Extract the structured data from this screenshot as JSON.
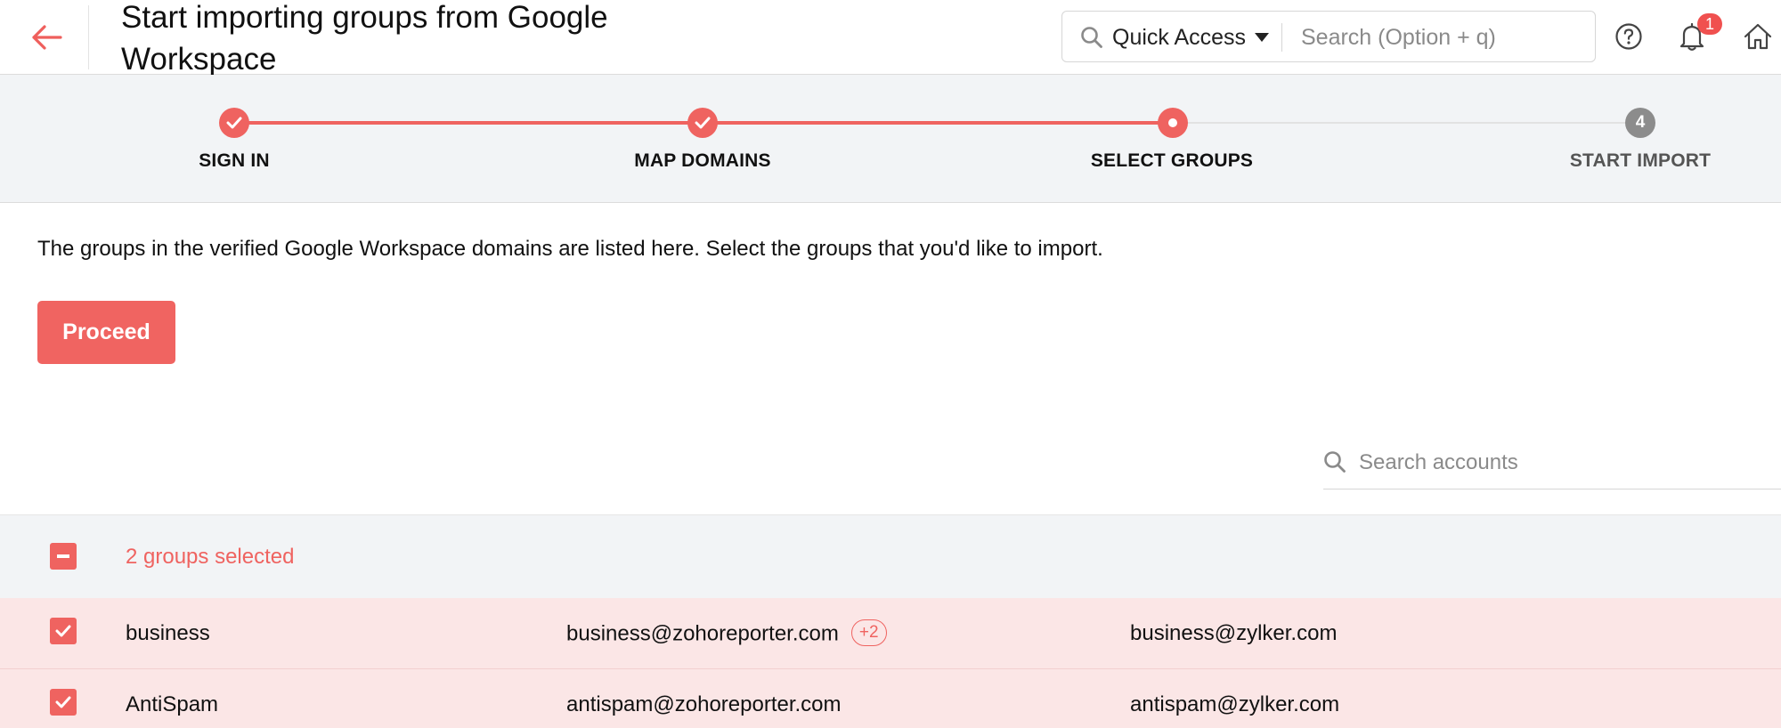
{
  "header": {
    "title": "Start importing groups from Google Workspace",
    "quick_access_label": "Quick Access",
    "search_placeholder": "Search (Option + q)",
    "notification_count": "1",
    "icons": {
      "back": "arrow-left-icon",
      "search": "search-icon",
      "help": "help-circle-icon",
      "notifications": "bell-icon",
      "home": "home-icon"
    }
  },
  "stepper": {
    "steps": [
      {
        "label": "SIGN IN",
        "state": "done"
      },
      {
        "label": "MAP DOMAINS",
        "state": "done"
      },
      {
        "label": "SELECT GROUPS",
        "state": "active"
      },
      {
        "label": "START IMPORT",
        "state": "todo",
        "number": "4"
      }
    ],
    "accent_color": "#ef6360"
  },
  "main": {
    "description": "The groups in the verified Google Workspace domains are listed here. Select the groups that you'd like to import.",
    "proceed_label": "Proceed",
    "search_accounts_placeholder": "Search accounts"
  },
  "table": {
    "selection_summary": "2 groups selected",
    "rows": [
      {
        "name": "business",
        "email": "business@zohoreporter.com",
        "extra": "+2",
        "alias": "business@zylker.com",
        "checked": true
      },
      {
        "name": "AntiSpam",
        "email": "antispam@zohoreporter.com",
        "alias": "antispam@zylker.com",
        "checked": true
      }
    ]
  }
}
